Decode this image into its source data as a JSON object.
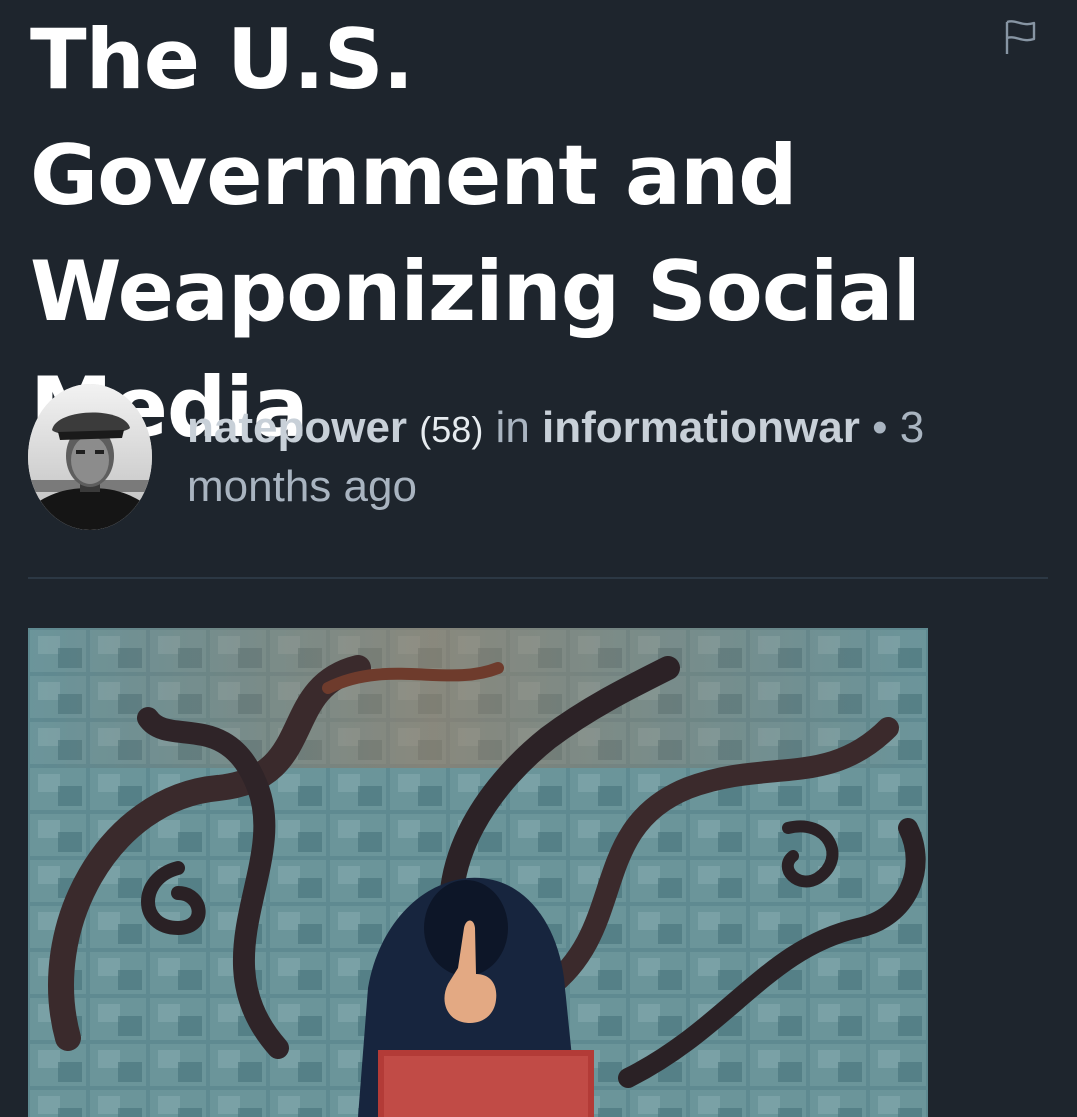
{
  "post": {
    "title": "The U.S. Government and Weaponizing Social Media",
    "author": "natepower",
    "reputation": "(58)",
    "in_label": "in",
    "community": "informationwar",
    "separator": "•",
    "time_ago": "3 months ago"
  },
  "icons": {
    "flag": "flag-icon",
    "avatar": "author-avatar"
  },
  "colors": {
    "background": "#1e252d",
    "title": "#ffffff",
    "meta": "#a9b4c0",
    "divider": "#2c3844"
  }
}
